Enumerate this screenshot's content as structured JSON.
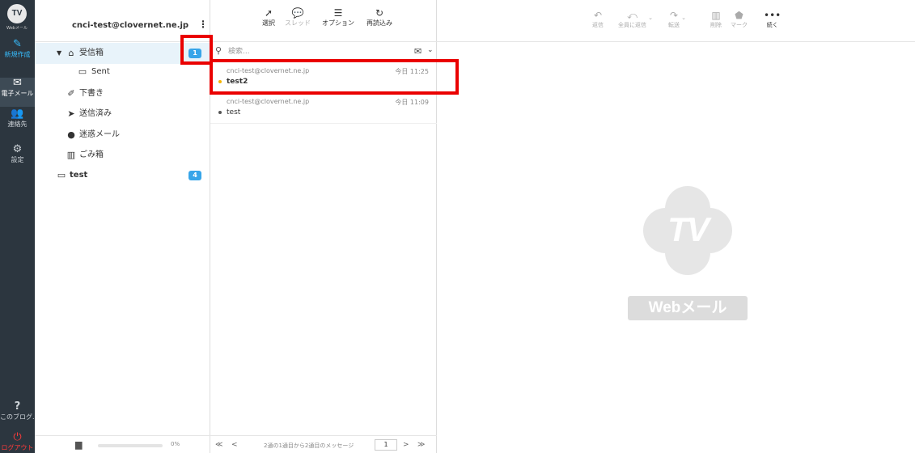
{
  "rail": {
    "logo_caption": "Webメール",
    "items": [
      {
        "label": "新規作成"
      },
      {
        "label": "電子メール"
      },
      {
        "label": "連絡先"
      },
      {
        "label": "設定"
      }
    ],
    "help_label": "このブログ...",
    "logout_label": "ログアウト"
  },
  "folders": {
    "account": "cnci-test@clovernet.ne.jp",
    "items": [
      {
        "name": "受信箱",
        "unread": "1"
      },
      {
        "name": "Sent"
      },
      {
        "name": "下書き"
      },
      {
        "name": "送信済み"
      },
      {
        "name": "迷惑メール"
      },
      {
        "name": "ごみ箱"
      },
      {
        "name": "test",
        "unread": "4"
      }
    ],
    "quota": {
      "text": "0%",
      "fraction": 0
    }
  },
  "list_toolbar": {
    "select": "選択",
    "thread": "スレッド",
    "options": "オプション",
    "refresh": "再読込み"
  },
  "search": {
    "placeholder": "検索..."
  },
  "messages": [
    {
      "from": "cnci-test@clovernet.ne.jp",
      "date": "今日 11:25",
      "subject": "test2",
      "unread": true
    },
    {
      "from": "cnci-test@clovernet.ne.jp",
      "date": "今日 11:09",
      "subject": "test",
      "unread": false
    }
  ],
  "pagination": {
    "first": "≪",
    "prev": "<",
    "info": "2通の1通目から2通目のメッセージ",
    "page": "1",
    "next": ">",
    "last": "≫"
  },
  "preview_toolbar": {
    "reply": "返信",
    "reply_all": "全員に返信",
    "forward": "転送",
    "delete": "削除",
    "mark": "マーク",
    "more": "続く"
  },
  "watermark": {
    "tv": "TV",
    "label": "Webメール"
  },
  "colors": {
    "rail_bg": "#2c363f",
    "accent": "#37a5e9",
    "compose": "#37beff",
    "logout": "#ff3b3b",
    "highlight": "#ea0000"
  }
}
